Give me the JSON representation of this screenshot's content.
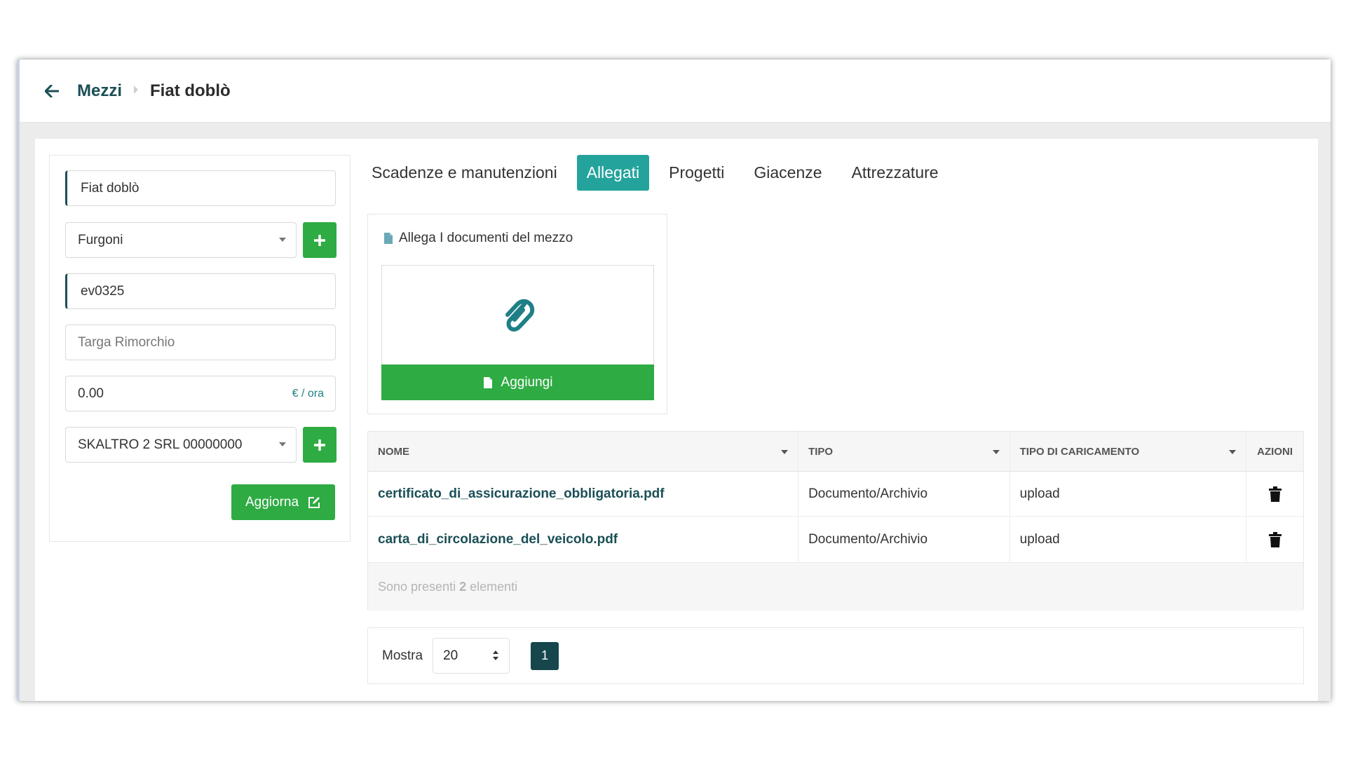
{
  "breadcrumb": {
    "parent": "Mezzi",
    "current": "Fiat doblò"
  },
  "form": {
    "name_value": "Fiat doblò",
    "category_value": "Furgoni",
    "plate_value": "ev0325",
    "trailer_plate_placeholder": "Targa Rimorchio",
    "cost_value": "0.00",
    "cost_suffix": "€ / ora",
    "company_value": "SKALTRO 2 SRL 00000000",
    "update_label": "Aggiorna"
  },
  "tabs": [
    {
      "label": "Scadenze e manutenzioni",
      "active": false
    },
    {
      "label": "Allegati",
      "active": true
    },
    {
      "label": "Progetti",
      "active": false
    },
    {
      "label": "Giacenze",
      "active": false
    },
    {
      "label": "Attrezzature",
      "active": false
    }
  ],
  "attach": {
    "title": "Allega I documenti del mezzo",
    "add_label": "Aggiungi"
  },
  "table": {
    "headers": [
      "NOME",
      "TIPO",
      "TIPO DI CARICAMENTO",
      "AZIONI"
    ],
    "rows": [
      {
        "name": "certificato_di_assicurazione_obbligatoria.pdf",
        "type": "Documento/Archivio",
        "upload": "upload"
      },
      {
        "name": "carta_di_circolazione_del_veicolo.pdf",
        "type": "Documento/Archivio",
        "upload": "upload"
      }
    ],
    "footer_prefix": "Sono presenti",
    "footer_count": "2",
    "footer_suffix": "elementi"
  },
  "pagination": {
    "show_label": "Mostra",
    "page_size": "20",
    "current_page": "1"
  },
  "colors": {
    "primary_green": "#2eab43",
    "active_tab": "#23a39b",
    "dark_teal": "#1b4f56"
  }
}
